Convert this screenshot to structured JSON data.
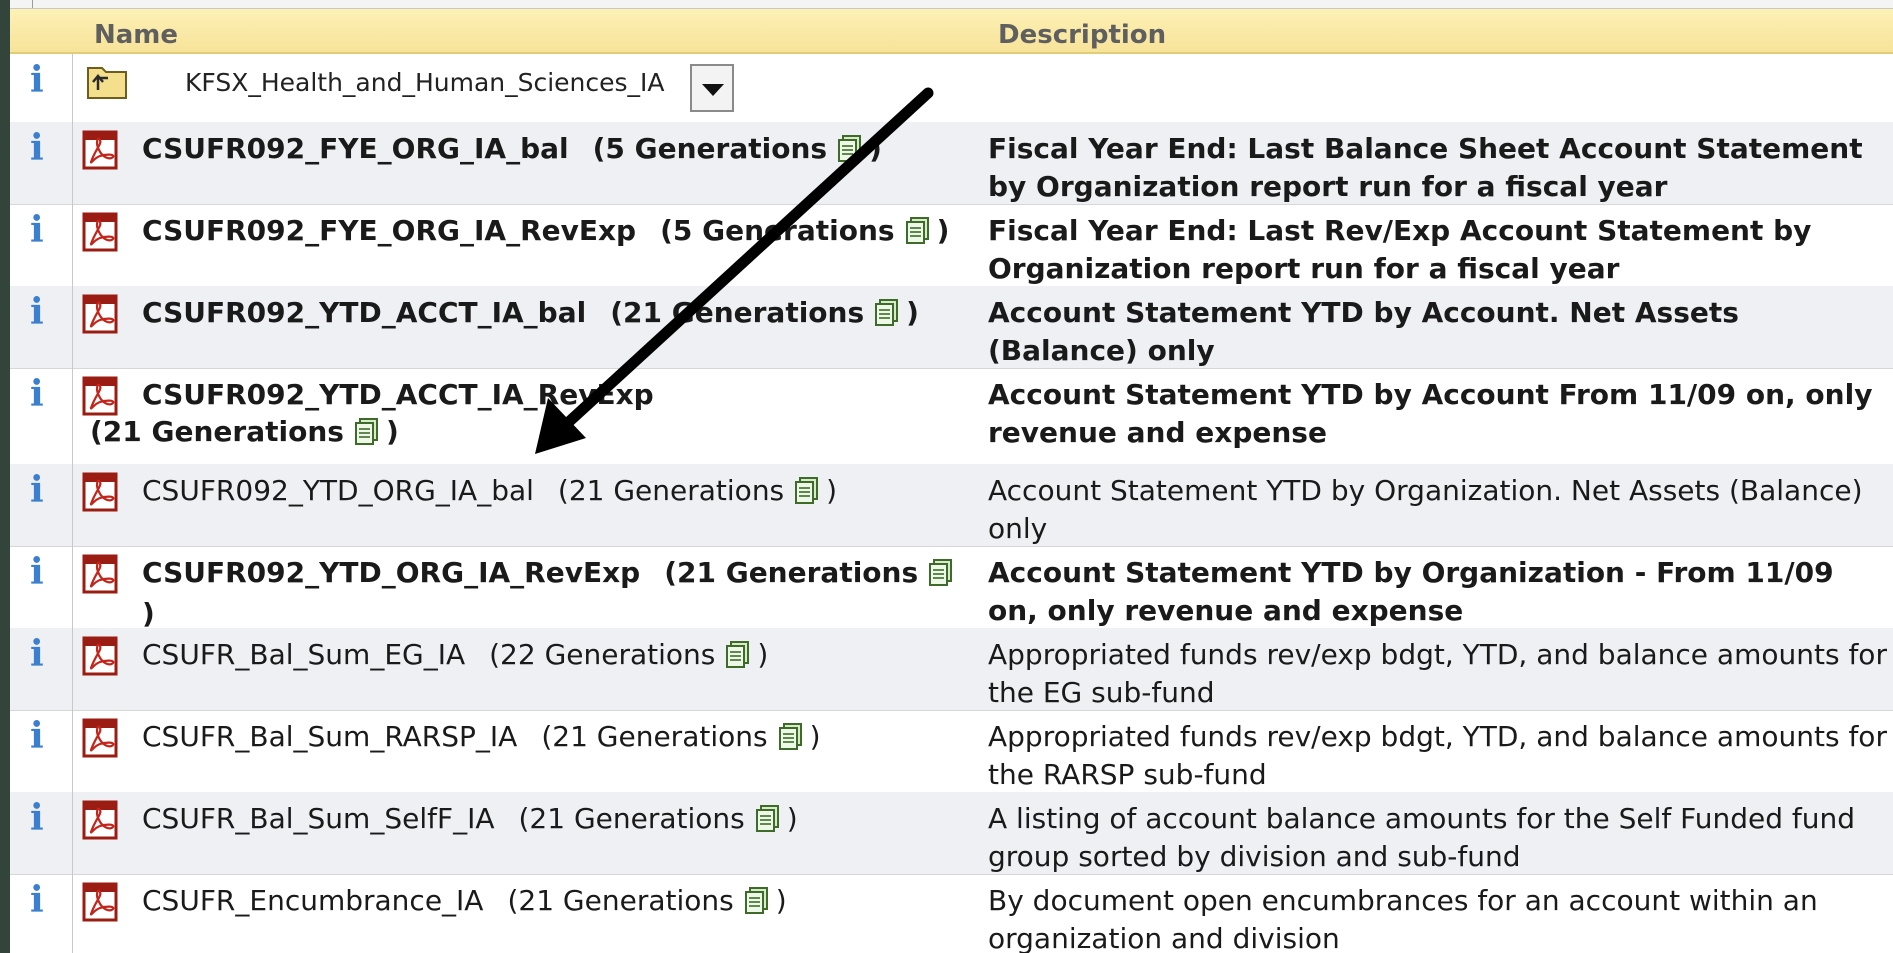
{
  "header": {
    "name_col": "Name",
    "description_col": "Description"
  },
  "folder": {
    "name": "KFSX_Health_and_Human_Sciences_IA",
    "icon": "folder-up-icon",
    "dropdown_icon": "chevron-down-icon"
  },
  "info_glyph": "i",
  "reports": [
    {
      "name": "CSUFR092_FYE_ORG_IA_bal",
      "generations": "(5 Generations",
      "description": "Fiscal Year End: Last Balance Sheet Account Statement by Organization report run for a fiscal year",
      "bold": true
    },
    {
      "name": "CSUFR092_FYE_ORG_IA_RevExp",
      "generations": "(5 Generations",
      "description": "Fiscal Year End: Last Rev/Exp Account Statement by Organization report run for a fiscal year",
      "bold": true
    },
    {
      "name": "CSUFR092_YTD_ACCT_IA_bal",
      "generations": "(21 Generations",
      "description": "Account Statement YTD by Account. Net Assets (Balance) only",
      "bold": true
    },
    {
      "name": "CSUFR092_YTD_ACCT_IA_RevExp",
      "generations": "(21 Generations",
      "description": "Account Statement YTD by Account From 11/09 on, only revenue and expense",
      "bold": true
    },
    {
      "name": "CSUFR092_YTD_ORG_IA_bal",
      "generations": "(21 Generations",
      "description": "Account Statement YTD by Organization. Net Assets (Balance) only",
      "bold": false
    },
    {
      "name": "CSUFR092_YTD_ORG_IA_RevExp",
      "generations": "(21 Generations",
      "description": "Account Statement YTD by Organization - From 11/09 on, only revenue and expense",
      "bold": true
    },
    {
      "name": "CSUFR_Bal_Sum_EG_IA",
      "generations": "(22 Generations",
      "description": "Appropriated funds rev/exp bdgt, YTD, and balance amounts for the EG sub-fund",
      "bold": false
    },
    {
      "name": "CSUFR_Bal_Sum_RARSP_IA",
      "generations": "(21 Generations",
      "description": "Appropriated funds rev/exp bdgt, YTD, and balance amounts for the RARSP sub-fund",
      "bold": false
    },
    {
      "name": "CSUFR_Bal_Sum_SelfF_IA",
      "generations": "(21 Generations",
      "description": "A listing of account balance amounts for the Self Funded fund group sorted by division and sub-fund",
      "bold": false
    },
    {
      "name": "CSUFR_Encumbrance_IA",
      "generations": "(21 Generations",
      "description": "By document open encumbrances for an account within an organization and division",
      "bold": false
    }
  ],
  "close_paren": ")"
}
